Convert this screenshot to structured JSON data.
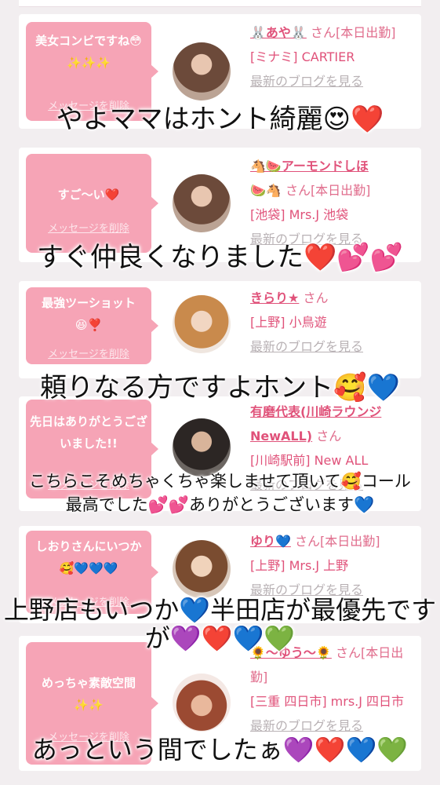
{
  "cards": [
    {
      "message": "美女コンビですね😳✨✨✨",
      "delete_label": "メッセージを削除",
      "name": "🐰あや🐰",
      "honorific": "さん[本日出勤]",
      "shop": "[ミナミ] CARTIER",
      "blog": "最新のブログを見る"
    },
    {
      "message": "すご〜い❤️",
      "delete_label": "メッセージを削除",
      "name": "🐴🍉アーモンドしほ",
      "name2": "🍉🐴",
      "honorific": "さん[本日出勤]",
      "shop": "[池袋] Mrs.J 池袋",
      "blog": "最新のブログを見る"
    },
    {
      "message": "最強ツーショット😆❣️",
      "delete_label": "メッセージを削除",
      "name": "きらり★",
      "honorific": "さん",
      "shop": "[上野] 小鳥遊",
      "blog": "最新のブログを見る"
    },
    {
      "message": "先日はありがとうございました!!",
      "delete_label": "メッセージを削除",
      "name": "有磨代表(川崎ラウンジNewALL)",
      "honorific": "さん",
      "shop": "[川崎駅前] New ALL",
      "blog": "最新のブログを見る"
    },
    {
      "message": "しおりさんにいつか🥰💙💙💙",
      "delete_label": "メッセージを削除",
      "name": "ゆり💙",
      "honorific": "さん[本日出勤]",
      "shop": "[上野] Mrs.J 上野",
      "blog": "最新のブログを見る"
    },
    {
      "message": "めっちゃ素敵空間✨✨",
      "delete_label": "メッセージを削除",
      "name": "🌻〜ゆう〜🌻",
      "honorific": "さん[本日出勤]",
      "shop": "[三重 四日市] mrs.J 四日市",
      "blog": "最新のブログを見る"
    }
  ],
  "overlays": [
    "やよママはホント綺麗😍❤️",
    "すぐ仲良くなりました❤️💕💕",
    "頼りなる方ですよホント🥰💙",
    "こちらこそめちゃくちゃ楽しませて頂いて🥰コール",
    "最高でした💕💕ありがとうございます💙",
    "上野店もいつか💙半田店が最優先です",
    "が💜❤️💙💚",
    "あっという間でしたぁ💜❤️💙💚"
  ],
  "colors": {
    "bubble": "#f6a4b6",
    "link": "#e0527a",
    "muted": "#b9b2b5",
    "background": "#f2eef0"
  }
}
